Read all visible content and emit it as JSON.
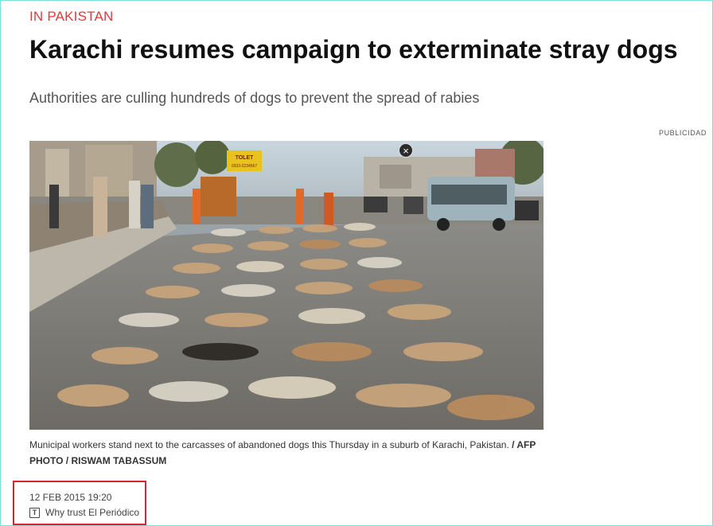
{
  "article": {
    "kicker": "IN PAKISTAN",
    "headline": "Karachi resumes campaign to exterminate stray dogs",
    "subtitle": "Authorities are culling hundreds of dogs to prevent the spread of rabies",
    "ad_label": "PUBLICIDAD"
  },
  "photo": {
    "sign_line1": "TOLET",
    "sign_line2": "0333-2234567",
    "close_glyph": "×",
    "close_icon": "close-icon"
  },
  "caption": {
    "text": "Municipal workers stand next to the carcasses of abandoned dogs this Thursday in a suburb of Karachi, Pakistan. ",
    "credit": "/ AFP PHOTO / RISWAM TABASSUM"
  },
  "meta": {
    "date": "12 FEB 2015 19:20",
    "trust_label": "Why trust El Periódico",
    "trust_icon": "trust-t-icon",
    "trust_glyph": "T",
    "highlight_color": "#d9232d"
  },
  "colors": {
    "kicker": "#e03a3a",
    "frame": "#7fdede"
  }
}
